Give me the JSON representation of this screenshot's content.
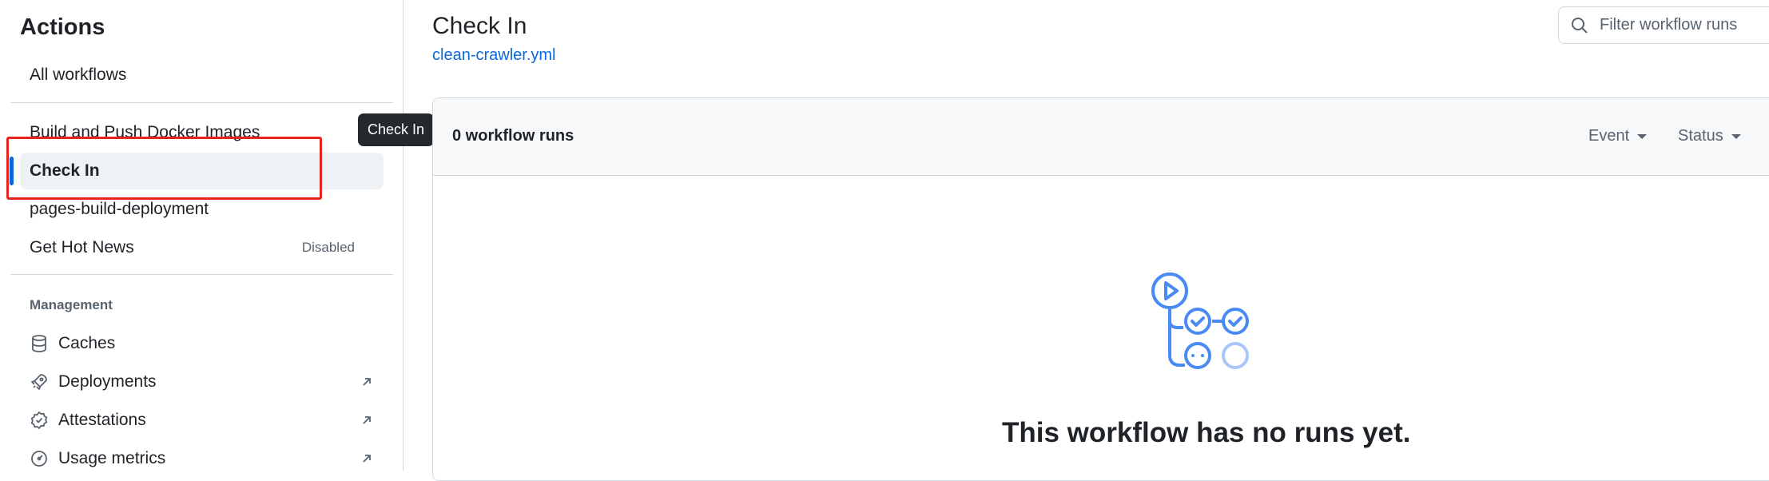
{
  "sidebar": {
    "title": "Actions",
    "all_workflows": "All workflows",
    "workflows": [
      {
        "label": "Build and Push Docker Images"
      },
      {
        "label": "Check In",
        "active": true
      },
      {
        "label": "pages-build-deployment"
      },
      {
        "label": "Get Hot News",
        "badge": "Disabled"
      }
    ],
    "management_label": "Management",
    "management": [
      {
        "label": "Caches",
        "icon": "database-icon"
      },
      {
        "label": "Deployments",
        "icon": "rocket-icon",
        "external": true
      },
      {
        "label": "Attestations",
        "icon": "verified-icon",
        "external": true
      },
      {
        "label": "Usage metrics",
        "icon": "meter-icon",
        "external": true
      }
    ]
  },
  "tooltip": {
    "text": "Check In"
  },
  "header": {
    "title": "Check In",
    "workflow_file": "clean-crawler.yml",
    "filter_placeholder": "Filter workflow runs"
  },
  "runs": {
    "count_label": "0 workflow runs",
    "event_filter": "Event",
    "status_filter": "Status"
  },
  "empty_state": {
    "title": "This workflow has no runs yet."
  },
  "colors": {
    "accent": "#0969da",
    "highlight": "#e8231c",
    "illustration": "#4a8af4"
  }
}
